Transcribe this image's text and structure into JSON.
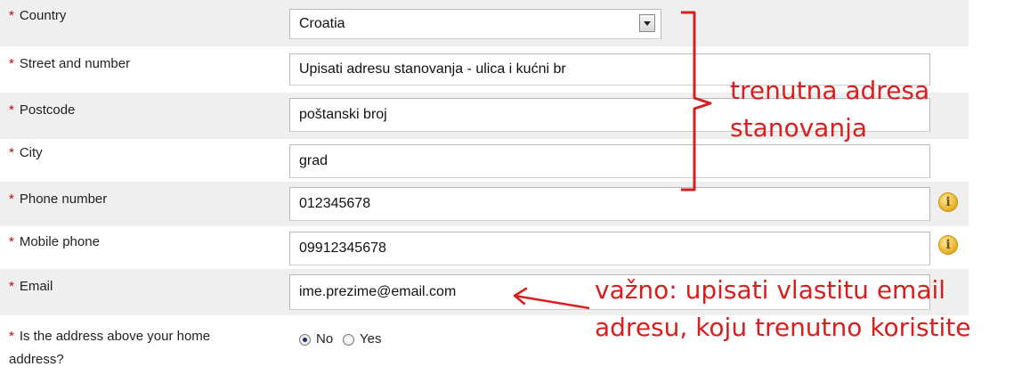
{
  "form": {
    "required_marker": "*",
    "country": {
      "label": "Country",
      "value": "Croatia"
    },
    "street": {
      "label": "Street and number",
      "value": "Upisati adresu stanovanja - ulica i kućni br"
    },
    "postcode": {
      "label": "Postcode",
      "value": "poštanski broj"
    },
    "city": {
      "label": "City",
      "value": "grad"
    },
    "phone": {
      "label": "Phone number",
      "value": "012345678"
    },
    "mobile": {
      "label": "Mobile phone",
      "value": "09912345678"
    },
    "email": {
      "label": "Email",
      "value": "ime.prezime@email.com"
    },
    "home_address": {
      "label_line1": "Is the address above your home",
      "label_line2": "address?",
      "options": [
        {
          "label": "No",
          "selected": true
        },
        {
          "label": "Yes",
          "selected": false
        }
      ]
    }
  },
  "annotations": {
    "address_line1": "trenutna adresa",
    "address_line2": "stanovanja",
    "email_line1": "važno: upisati vlastitu email",
    "email_line2": "adresu, koju trenutno koristite"
  },
  "colors": {
    "annotation": "#d81e1e",
    "required": "#cc0000",
    "row_shade": "#efefef"
  },
  "icons": {
    "info": "info-icon",
    "dropdown": "chevron-down-icon"
  }
}
